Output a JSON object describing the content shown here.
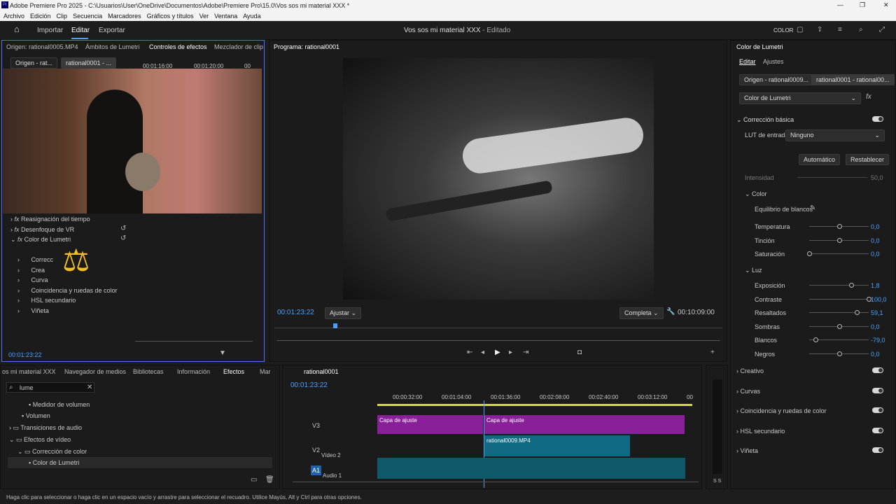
{
  "window": {
    "title": "Adobe Premiere Pro 2025 - C:\\Usuarios\\User\\OneDrive\\Documentos\\Adobe\\Premiere Pro\\15.0\\Vos sos mi material XXX *",
    "min": "—",
    "max": "❐",
    "close": "✕"
  },
  "menu": [
    "Archivo",
    "Edición",
    "Clip",
    "Secuencia",
    "Marcadores",
    "Gráficos y títulos",
    "Ver",
    "Ventana",
    "Ayuda"
  ],
  "header": {
    "tabs": [
      "Importar",
      "Editar",
      "Exportar"
    ],
    "project_title": "Vos sos mi material XXX",
    "status": " - Editado",
    "color_label": "COLOR"
  },
  "source_panel": {
    "tabs": [
      "Origen: rational0005.MP4",
      "Ámbitos de Lumetri",
      "Controles de efectos",
      "Mezclador de clip"
    ],
    "subtabs": [
      "Origen - rat...",
      "rational0001 - ..."
    ],
    "ruler": [
      "00:01:16:00",
      "00:01:20:00",
      "00"
    ],
    "effects": [
      "Reasignación del tiempo",
      "Desenfoque de VR",
      "Color de Lumetri"
    ],
    "lumetri_items": [
      "Correcc",
      "Crea",
      "Curva",
      "Coincidencia y ruedas de color",
      "HSL secundario",
      "Viñeta"
    ],
    "timecode": "00:01:23:22"
  },
  "program": {
    "title": "Programa: rational0001",
    "timecode": "00:01:23:22",
    "fit": "Ajustar",
    "quality": "Completa",
    "duration": "00:10:09:00"
  },
  "project_panel": {
    "tabs": [
      "os mi material XXX",
      "Navegador de medios",
      "Bibliotecas",
      "Información",
      "Efectos",
      "Mar"
    ],
    "search": "lume",
    "items": [
      "Medidor de volumen",
      "Volumen",
      "Transiciones de audio",
      "Efectos de vídeo",
      "Corrección de color",
      "Color de Lumetri"
    ]
  },
  "timeline": {
    "title": "rational0001",
    "timecode": "00:01:23:22",
    "ruler": [
      "00:00:32:00",
      "00:01:04:00",
      "00:01:36:00",
      "00:02:08:00",
      "00:02:40:00",
      "00:03:12:00",
      "00"
    ],
    "tracks": [
      {
        "name": "V3"
      },
      {
        "name": "V2",
        "label": "Vídeo 2"
      },
      {
        "name": "A1",
        "label": "Audio 1"
      }
    ],
    "clips": [
      "Capa de ajuste",
      "Capa de ajuste",
      "rational0009.MP4"
    ],
    "meter": "S S"
  },
  "lumetri": {
    "title": "Color de Lumetri",
    "tabs": [
      "Editar",
      "Ajustes"
    ],
    "sources": [
      "Origen - rational0009...",
      "rational0001 - rational00..."
    ],
    "effect": "Color de Lumetri",
    "section": "Corrección básica",
    "lut_label": "LUT de entrada",
    "lut_value": "Ninguno",
    "auto": "Automático",
    "reset": "Restablecer",
    "intensity_label": "Intensidad",
    "intensity_value": "50,0",
    "color_label": "Color",
    "wb_label": "Equilibrio de blancos",
    "params": [
      {
        "label": "Temperatura",
        "value": "0,0",
        "pos": 0.5
      },
      {
        "label": "Tinción",
        "value": "0,0",
        "pos": 0.5
      },
      {
        "label": "Saturación",
        "value": "0,0",
        "pos": 0.0
      }
    ],
    "light_label": "Luz",
    "light": [
      {
        "label": "Exposición",
        "value": "1,8",
        "pos": 0.7
      },
      {
        "label": "Contraste",
        "value": "100,0",
        "pos": 1.0
      },
      {
        "label": "Resaltados",
        "value": "59,1",
        "pos": 0.8
      },
      {
        "label": "Sombras",
        "value": "0,0",
        "pos": 0.5
      },
      {
        "label": "Blancos",
        "value": "-79,0",
        "pos": 0.1
      },
      {
        "label": "Negros",
        "value": "0,0",
        "pos": 0.5
      }
    ],
    "sections": [
      "Creativo",
      "Curvas",
      "Coincidencia y ruedas de color",
      "HSL secundario",
      "Viñeta"
    ]
  },
  "statusbar": "Haga clic para seleccionar o haga clic en un espacio vacío y arrastre para seleccionar el recuadro. Utilice Mayús, Alt y Ctrl para otras opciones."
}
